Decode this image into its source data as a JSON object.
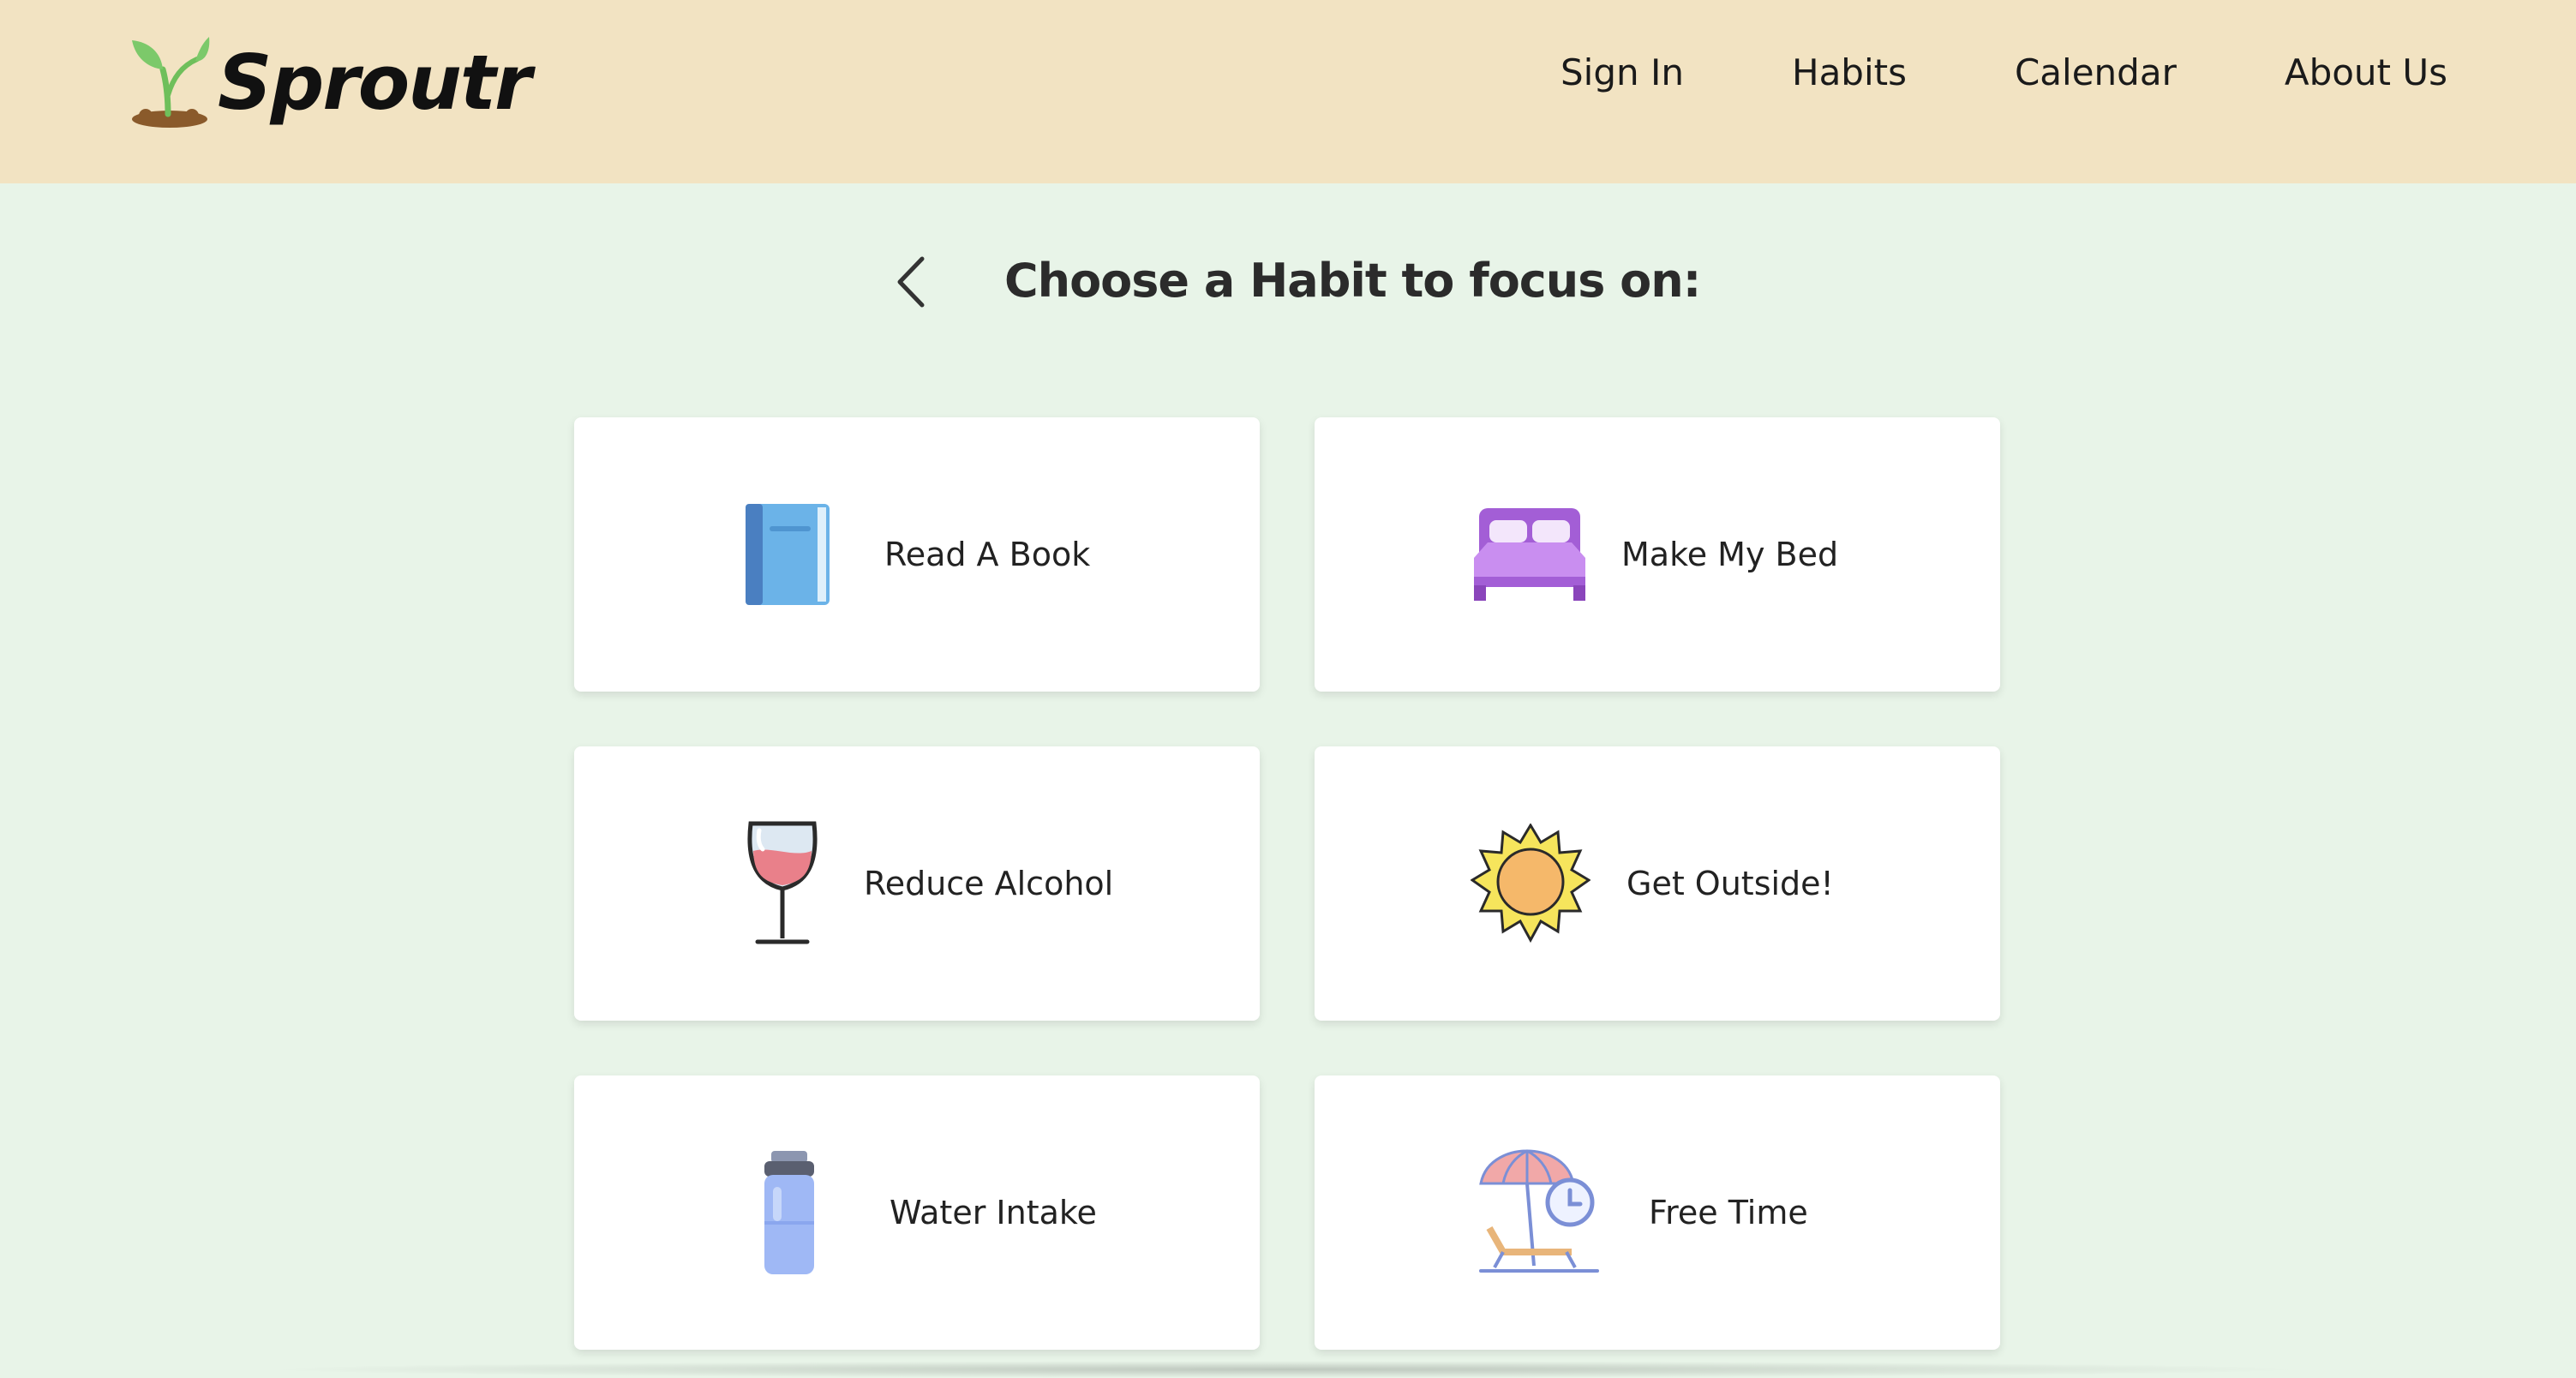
{
  "brand": {
    "name": "Sproutr"
  },
  "nav": {
    "items": [
      {
        "label": "Sign In"
      },
      {
        "label": "Habits"
      },
      {
        "label": "Calendar"
      },
      {
        "label": "About Us"
      }
    ]
  },
  "main": {
    "title": "Choose a Habit to focus on:",
    "habits": [
      {
        "label": "Read A Book",
        "icon": "book-icon"
      },
      {
        "label": "Make My Bed",
        "icon": "bed-icon"
      },
      {
        "label": "Reduce Alcohol",
        "icon": "wine-glass-icon"
      },
      {
        "label": "Get Outside!",
        "icon": "sun-icon"
      },
      {
        "label": "Water Intake",
        "icon": "water-bottle-icon"
      },
      {
        "label": "Free Time",
        "icon": "beach-umbrella-icon"
      }
    ]
  },
  "colors": {
    "navbar_bg": "#f2e3c2",
    "page_bg": "#e8f4e8",
    "card_bg": "#ffffff"
  }
}
